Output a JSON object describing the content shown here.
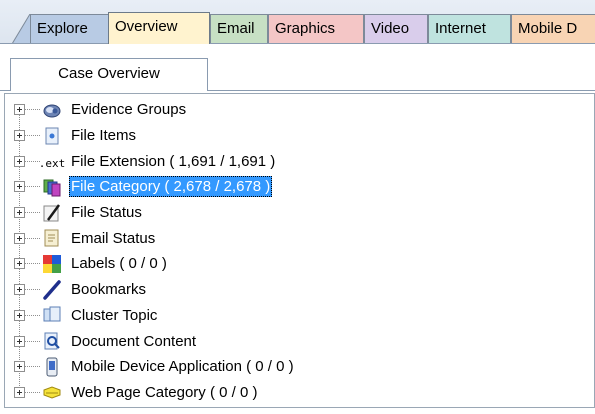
{
  "tabs": [
    {
      "key": "explore",
      "label": "Explore"
    },
    {
      "key": "overview",
      "label": "Overview",
      "active": true
    },
    {
      "key": "email",
      "label": "Email"
    },
    {
      "key": "graphics",
      "label": "Graphics"
    },
    {
      "key": "video",
      "label": "Video"
    },
    {
      "key": "internet",
      "label": "Internet"
    },
    {
      "key": "mobile",
      "label": "Mobile D"
    }
  ],
  "subtab": {
    "label": "Case Overview"
  },
  "tree": {
    "selected_index": 3,
    "items": [
      {
        "label": "Evidence Groups",
        "icon": "evidence-groups-icon"
      },
      {
        "label": "File Items",
        "icon": "file-items-icon"
      },
      {
        "label": "File Extension ( 1,691 / 1,691 )",
        "icon": "file-extension-icon",
        "icon_text": ".ext"
      },
      {
        "label": "File Category ( 2,678 / 2,678 )",
        "icon": "file-category-icon"
      },
      {
        "label": "File Status",
        "icon": "file-status-icon"
      },
      {
        "label": "Email Status",
        "icon": "email-status-icon"
      },
      {
        "label": "Labels ( 0 / 0 )",
        "icon": "labels-icon"
      },
      {
        "label": "Bookmarks",
        "icon": "bookmarks-icon"
      },
      {
        "label": "Cluster Topic",
        "icon": "cluster-topic-icon"
      },
      {
        "label": "Document Content",
        "icon": "document-content-icon"
      },
      {
        "label": "Mobile Device Application ( 0 / 0 )",
        "icon": "mobile-device-icon"
      },
      {
        "label": "Web Page Category ( 0 / 0 )",
        "icon": "web-page-category-icon"
      }
    ]
  },
  "colors": {
    "selection": "#3399ff",
    "tab_explore": "#b8cbe4",
    "tab_overview": "#fff3cf",
    "tab_email": "#c7e0c4",
    "tab_graphics": "#f4c6c6",
    "tab_video": "#d9cdeb",
    "tab_internet": "#bfe3df",
    "tab_mobile": "#f8d4b4"
  }
}
